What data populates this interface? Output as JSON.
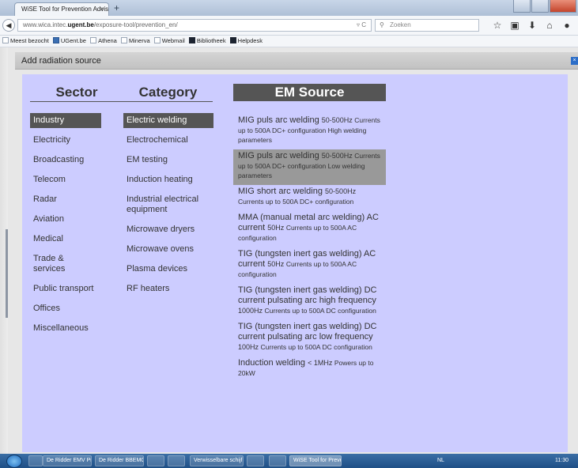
{
  "browser": {
    "tab_title": "WiSE Tool for Prevention Advis...",
    "tab_close": "×",
    "new_tab": "+",
    "url_prefix": "www.wica.intec.",
    "url_domain": "ugent.be",
    "url_path": "/exposure-tool/prevention_en/",
    "reload_icon": "▿ C",
    "search_placeholder": "Zoeken",
    "bookmarks": [
      "Meest bezocht",
      "UGent.be",
      "Athena",
      "Minerva",
      "Webmail",
      "Bibliotheek",
      "Helpdesk"
    ]
  },
  "dialog": {
    "title": "Add radiation source",
    "close_label": "×"
  },
  "columns": {
    "sector_header": "Sector",
    "category_header": "Category",
    "em_header": "EM Source"
  },
  "sectors": [
    {
      "label": "Industry",
      "active": true
    },
    {
      "label": "Electricity",
      "active": false
    },
    {
      "label": "Broadcasting",
      "active": false
    },
    {
      "label": "Telecom",
      "active": false
    },
    {
      "label": "Radar",
      "active": false
    },
    {
      "label": "Aviation",
      "active": false
    },
    {
      "label": "Medical",
      "active": false
    },
    {
      "label": "Trade & services",
      "active": false
    },
    {
      "label": "Public transport",
      "active": false
    },
    {
      "label": "Offices",
      "active": false
    },
    {
      "label": "Miscellaneous",
      "active": false
    }
  ],
  "categories": [
    {
      "label": "Electric welding",
      "active": true
    },
    {
      "label": "Electrochemical",
      "active": false
    },
    {
      "label": "EM testing",
      "active": false
    },
    {
      "label": "Induction heating",
      "active": false
    },
    {
      "label": "Industrial electrical equipment",
      "active": false
    },
    {
      "label": "Microwave dryers",
      "active": false
    },
    {
      "label": "Microwave ovens",
      "active": false
    },
    {
      "label": "Plasma devices",
      "active": false
    },
    {
      "label": "RF heaters",
      "active": false
    }
  ],
  "em_sources": [
    {
      "name": "MIG puls arc welding",
      "freq": "50-500Hz",
      "details": "Currents up to 500A DC+ configuration High welding parameters",
      "active": false
    },
    {
      "name": "MIG puls arc welding",
      "freq": "50-500Hz",
      "details": "Currents up to 500A DC+ configuration Low welding parameters",
      "active": true
    },
    {
      "name": "MIG short arc welding",
      "freq": "50-500Hz",
      "details": "Currents up to 500A DC+ configuration",
      "active": false
    },
    {
      "name": "MMA (manual metal arc welding) AC current",
      "freq": "50Hz",
      "details": "Currents up to 500A AC configuration",
      "active": false
    },
    {
      "name": "TIG (tungsten inert gas welding) AC current",
      "freq": "50Hz",
      "details": "Currents up to 500A AC configuration",
      "active": false
    },
    {
      "name": "TIG (tungsten inert gas welding) DC current pulsating arc high frequency",
      "freq": "1000Hz",
      "details": "Currents up to 500A DC configuration",
      "active": false
    },
    {
      "name": "TIG (tungsten inert gas welding) DC current pulsating arc low frequency",
      "freq": "100Hz",
      "details": "Currents up to 500A DC configuration",
      "active": false
    },
    {
      "name": "Induction welding",
      "freq": "< 1MHz",
      "details": "Powers up to 20kW",
      "active": false
    }
  ],
  "taskbar": {
    "items": [
      "",
      "De Ridder EMV Pro...",
      "De Ridder BBEMG 2...",
      "",
      "",
      "Verwisselbare schijf...",
      "",
      "",
      "WiSE Tool for Preve..."
    ],
    "tray_lang": "NL",
    "clock": "11:30"
  }
}
